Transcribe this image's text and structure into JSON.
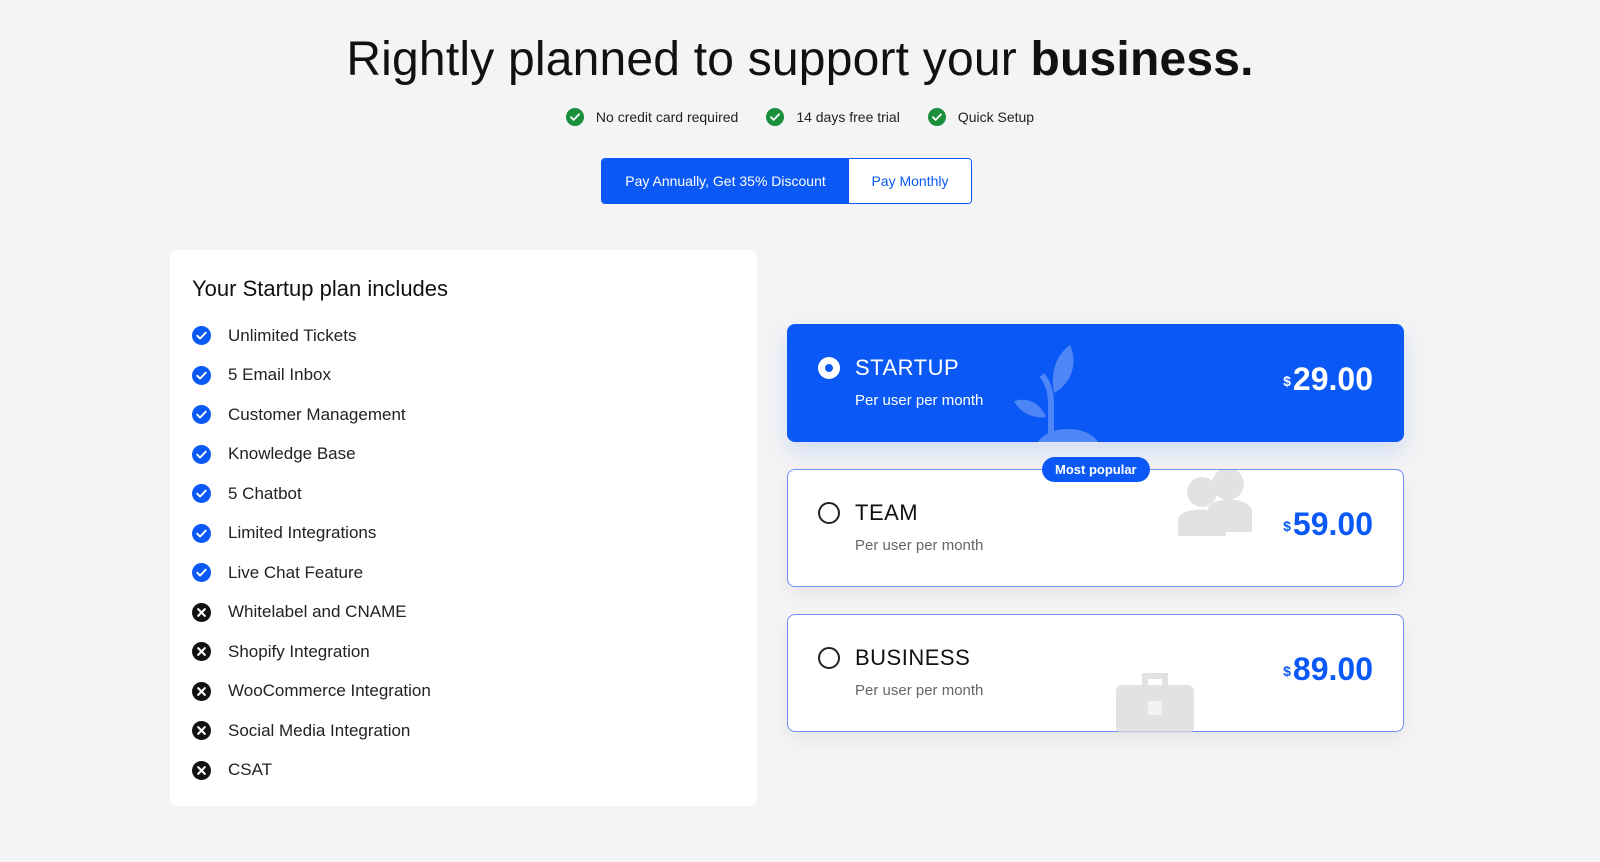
{
  "header": {
    "title_prefix": "Rightly planned to support your ",
    "title_bold": "business.",
    "perks": [
      "No credit card required",
      "14 days free trial",
      "Quick Setup"
    ]
  },
  "billing_toggle": {
    "annual_label": "Pay Annually, Get 35% Discount",
    "monthly_label": "Pay Monthly",
    "selected": "annual"
  },
  "features_panel": {
    "title": "Your Startup plan includes",
    "items": [
      {
        "label": "Unlimited Tickets",
        "included": true
      },
      {
        "label": "5 Email Inbox",
        "included": true
      },
      {
        "label": "Customer Management",
        "included": true
      },
      {
        "label": "Knowledge Base",
        "included": true
      },
      {
        "label": "5 Chatbot",
        "included": true
      },
      {
        "label": "Limited Integrations",
        "included": true
      },
      {
        "label": "Live Chat Feature",
        "included": true
      },
      {
        "label": "Whitelabel and CNAME",
        "included": false
      },
      {
        "label": "Shopify Integration",
        "included": false
      },
      {
        "label": "WooCommerce Integration",
        "included": false
      },
      {
        "label": "Social Media Integration",
        "included": false
      },
      {
        "label": "CSAT",
        "included": false
      }
    ]
  },
  "plans": [
    {
      "name": "STARTUP",
      "sub": "Per user per month",
      "currency": "$",
      "price": "29.00",
      "selected": true,
      "icon": "plant-icon"
    },
    {
      "name": "TEAM",
      "sub": "Per user per month",
      "currency": "$",
      "price": "59.00",
      "selected": false,
      "badge": "Most popular",
      "icon": "users-icon"
    },
    {
      "name": "BUSINESS",
      "sub": "Per user per month",
      "currency": "$",
      "price": "89.00",
      "selected": false,
      "icon": "briefcase-icon"
    }
  ],
  "colors": {
    "accent": "#0a58f5",
    "perk_check": "#1a8f3c",
    "included_check": "#0a58f5",
    "excluded_x": "#111111",
    "background": "#f4f4f4"
  }
}
